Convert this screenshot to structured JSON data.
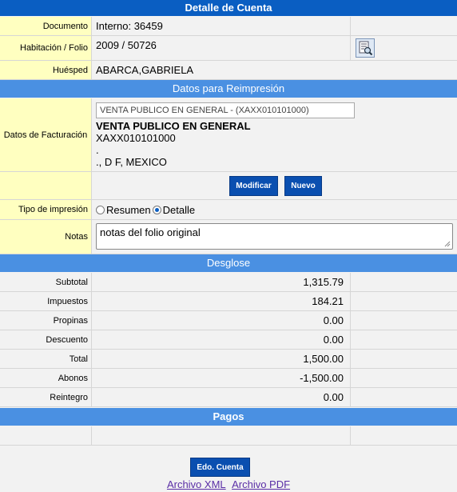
{
  "title": "Detalle de Cuenta",
  "documento": {
    "label": "Documento",
    "value": "Interno: 36459"
  },
  "habitacion": {
    "label": "Habitación / Folio",
    "value": "2009 / 50726",
    "icon": "search-document-icon"
  },
  "huesped": {
    "label": "Huésped",
    "value": "ABARCA,GABRIELA"
  },
  "reimpresion": {
    "section": "Datos para Reimpresión",
    "facturacion_label": "Datos de Facturación",
    "facturacion_select": "VENTA PUBLICO EN GENERAL - (XAXX010101000)",
    "nombre": "VENTA PUBLICO EN GENERAL",
    "rfc": "XAXX010101000",
    "linea3": ".",
    "linea4": "., D F, MEXICO",
    "modificar": "Modificar",
    "nuevo": "Nuevo",
    "tipo_label": "Tipo de impresión",
    "opcion_resumen": "Resumen",
    "opcion_detalle": "Detalle",
    "selected": "Detalle",
    "notas_label": "Notas",
    "notas_value": "notas del folio original"
  },
  "desglose": {
    "section": "Desglose",
    "rows": [
      {
        "label": "Subtotal",
        "value": "1,315.79"
      },
      {
        "label": "Impuestos",
        "value": "184.21"
      },
      {
        "label": "Propinas",
        "value": "0.00"
      },
      {
        "label": "Descuento",
        "value": "0.00"
      },
      {
        "label": "Total",
        "value": "1,500.00"
      },
      {
        "label": "Abonos",
        "value": "-1,500.00"
      },
      {
        "label": "Reintegro",
        "value": "0.00"
      }
    ]
  },
  "pagos": {
    "section": "Pagos"
  },
  "footer": {
    "edo_cuenta": "Edo. Cuenta",
    "archivo_xml": "Archivo XML",
    "archivo_pdf": "Archivo PDF"
  }
}
